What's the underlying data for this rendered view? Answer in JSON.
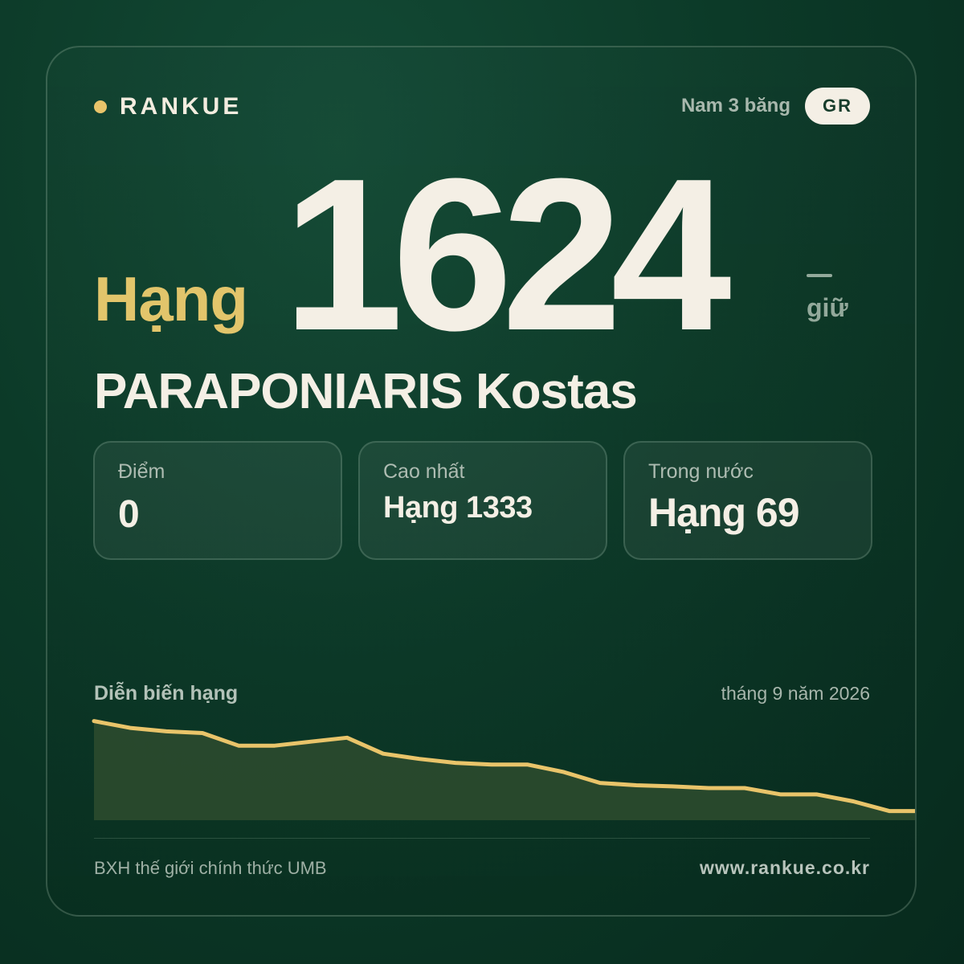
{
  "brand": {
    "name": "RANKUE",
    "dot_color": "#e9c46a"
  },
  "header": {
    "division": "Nam 3 băng",
    "country_code": "GR"
  },
  "rank": {
    "label": "Hạng",
    "number": "1624",
    "trend_symbol": "—",
    "trend_text": "giữ"
  },
  "player": {
    "name": "PARAPONIARIS Kostas"
  },
  "stats": [
    {
      "label": "Điểm",
      "value": "0"
    },
    {
      "label": "Cao nhất",
      "value": "Hạng 1333"
    },
    {
      "label": "Trong nước",
      "value": "Hạng 69"
    }
  ],
  "chart_section": {
    "title": "Diễn biến hạng",
    "date": "tháng 9 năm 2026"
  },
  "chart_data": {
    "type": "area",
    "y_inverted": true,
    "values": [
      1502,
      1514,
      1520,
      1523,
      1545,
      1545,
      1538,
      1531,
      1559,
      1568,
      1575,
      1578,
      1578,
      1591,
      1610,
      1614,
      1616,
      1619,
      1619,
      1630,
      1630,
      1642,
      1659,
      1659
    ],
    "ylim": [
      1490,
      1675
    ],
    "line_color": "#e9c46a",
    "fill_color": "#2a4a2d"
  },
  "footer": {
    "source": "BXH thế giới chính thức UMB",
    "website": "www.rankue.co.kr"
  },
  "colors": {
    "accent": "#e2c56b",
    "text_primary": "#f4efe5",
    "background": "#0c3a28"
  }
}
